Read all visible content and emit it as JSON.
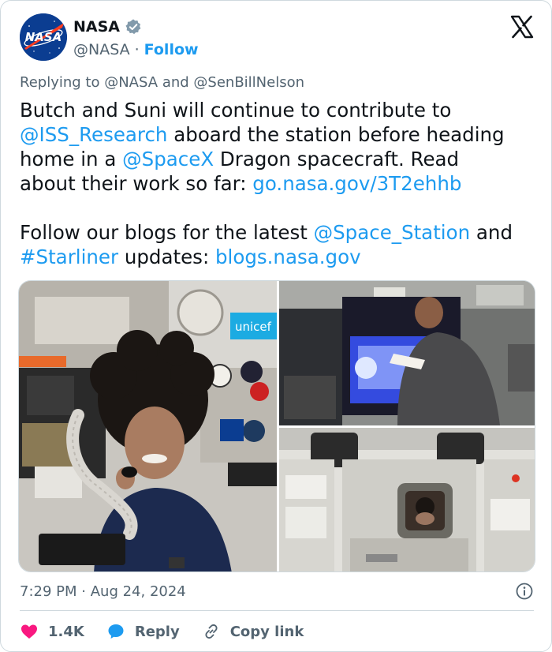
{
  "author": {
    "name": "NASA",
    "handle": "@NASA",
    "separator": "·",
    "follow_label": "Follow",
    "avatar_text": "NASA"
  },
  "reply_context": {
    "prefix": "Replying to",
    "mention_1": "@NASA",
    "joiner": "and",
    "mention_2": "@SenBillNelson"
  },
  "tweet": {
    "line1": "Butch and Suni will continue to contribute to",
    "line2_mention": "@ISS_Research",
    "line2_rest": " aboard the station before heading",
    "line3_pre": "home in a ",
    "line3_mention": "@SpaceX",
    "line3_rest": " Dragon spacecraft. Read",
    "line4_pre": "about their work so far: ",
    "line4_link": "go.nasa.gov/3T2ehhb",
    "line5_pre": "Follow our blogs for the latest ",
    "line5_mention": "@Space_Station",
    "line5_rest": " and",
    "line6_hashtag": "#Starliner",
    "line6_mid": " updates: ",
    "line6_link": "blogs.nasa.gov"
  },
  "media": {
    "photo1_label": "unicef"
  },
  "meta": {
    "time": "7:29 PM",
    "separator": "·",
    "date": "Aug 24, 2024"
  },
  "actions": {
    "like_count": "1.4K",
    "reply_label": "Reply",
    "copy_label": "Copy link"
  },
  "colors": {
    "link": "#1d9bf0",
    "like": "#f91880",
    "reply_bubble": "#1d9bf0",
    "secondary_text": "#536471",
    "nasa_blue": "#0b3d91",
    "nasa_red": "#fc3d21"
  }
}
